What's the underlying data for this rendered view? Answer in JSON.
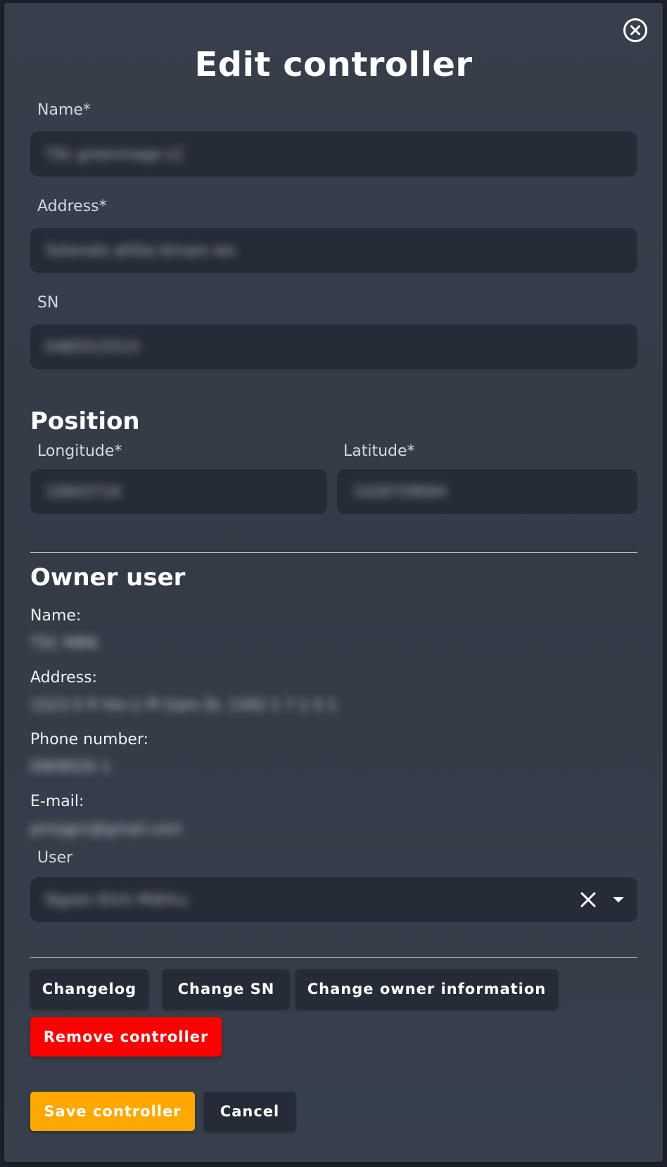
{
  "dialog": {
    "title": "Edit controller"
  },
  "fields": {
    "name": {
      "label": "Name*",
      "value": "Tốc greenmage LC"
    },
    "address": {
      "label": "Address*",
      "value": "Sotorate attiko binsen wo"
    },
    "sn": {
      "label": "SN",
      "value": "0485515515"
    }
  },
  "position": {
    "heading": "Position",
    "longitude": {
      "label": "Longitude*",
      "value": "10643716"
    },
    "latitude": {
      "label": "Latitude*",
      "value": "1028759694"
    }
  },
  "owner": {
    "heading": "Owner user",
    "name_label": "Name:",
    "name_value": "TSC MBN",
    "address_label": "Address:",
    "address_value": "1523 5 Fi hlo Li Pi Gam St, 1342 1 7 1 5 1",
    "phone_label": "Phone number:",
    "phone_value": "0909020 1",
    "email_label": "E-mail:",
    "email_value": "pmsgp1@gmail.com",
    "user_label": "User",
    "user_value": "Ngoen Đinh Miêthu"
  },
  "actions": {
    "changelog": "Changelog",
    "change_sn": "Change SN",
    "change_owner": "Change owner information",
    "remove": "Remove controller",
    "save": "Save controller",
    "cancel": "Cancel"
  },
  "icons": {
    "close": "close-circle-icon",
    "clear": "clear-x-icon",
    "caret": "caret-down-icon"
  },
  "colors": {
    "danger": "#ff0000",
    "primary": "#ffa800"
  }
}
